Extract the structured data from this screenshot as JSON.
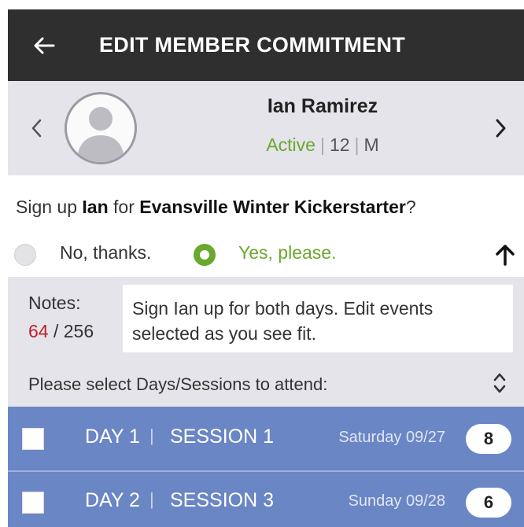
{
  "header": {
    "title": "EDIT MEMBER COMMITMENT"
  },
  "member": {
    "name": "Ian Ramirez",
    "status": "Active",
    "age": "12",
    "gender": "M"
  },
  "question": {
    "prefix": "Sign up ",
    "name": "Ian",
    "middle": " for ",
    "event": "Evansville Winter Kickerstarter",
    "suffix": "?"
  },
  "options": {
    "no_label": "No, thanks.",
    "yes_label": "Yes, please.",
    "selected": "yes"
  },
  "notes": {
    "label": "Notes:",
    "used": "64",
    "separator": " / ",
    "max": "256",
    "text": "Sign Ian up for both days.  Edit events selected as you see fit."
  },
  "sessions_prompt": "Please select Days/Sessions to attend:",
  "sessions": [
    {
      "day": "DAY 1",
      "session": "SESSION 1",
      "date": "Saturday 09/27",
      "count": "8",
      "checked": false
    },
    {
      "day": "DAY 2",
      "session": "SESSION 3",
      "date": "Sunday 09/28",
      "count": "6",
      "checked": false
    }
  ],
  "colors": {
    "header_bg": "#2f2f2f",
    "accent_green": "#6aa82e",
    "row_bg": "#6b86c4",
    "count_red": "#c0202a"
  },
  "icons": [
    "back-arrow-icon",
    "chevron-left-icon",
    "chevron-right-icon",
    "avatar-icon",
    "arrow-up-icon",
    "sort-icon"
  ]
}
